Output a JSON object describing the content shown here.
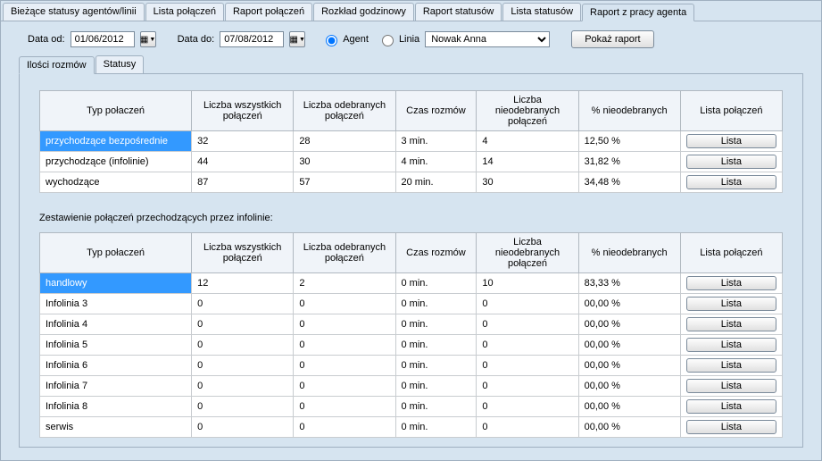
{
  "mainTabs": {
    "t0": "Bieżące statusy agentów/linii",
    "t1": "Lista połączeń",
    "t2": "Raport połączeń",
    "t3": "Rozkład godzinowy",
    "t4": "Raport statusów",
    "t5": "Lista statusów",
    "t6": "Raport z pracy agenta"
  },
  "filters": {
    "dateFromLabel": "Data od:",
    "dateFromValue": "01/06/2012",
    "dateToLabel": "Data do:",
    "dateToValue": "07/08/2012",
    "agentLabel": "Agent",
    "lineLabel": "Linia",
    "agentSelected": "Nowak Anna",
    "showReport": "Pokaż raport"
  },
  "subTabs": {
    "s0": "Ilości rozmów",
    "s1": "Statusy"
  },
  "headers": {
    "type": "Typ połaczeń",
    "all": "Liczba wszystkich połączeń",
    "answered": "Liczba odebranych połączeń",
    "time": "Czas rozmów",
    "missed": "Liczba nieodebranych połączeń",
    "pct": "% nieodebranych",
    "list": "Lista połączeń"
  },
  "listBtn": "Lista",
  "table1": {
    "r0": {
      "c0": "przychodzące bezpośrednie",
      "c1": "32",
      "c2": "28",
      "c3": "3 min.",
      "c4": "4",
      "c5": "12,50 %"
    },
    "r1": {
      "c0": "przychodzące (infolinie)",
      "c1": "44",
      "c2": "30",
      "c3": "4 min.",
      "c4": "14",
      "c5": "31,82 %"
    },
    "r2": {
      "c0": "wychodzące",
      "c1": "87",
      "c2": "57",
      "c3": "20 min.",
      "c4": "30",
      "c5": "34,48 %"
    }
  },
  "sectionLabel": "Zestawienie połączeń przechodzących przez infolinie:",
  "table2": {
    "r0": {
      "c0": "handlowy",
      "c1": "12",
      "c2": "2",
      "c3": "0 min.",
      "c4": "10",
      "c5": "83,33 %"
    },
    "r1": {
      "c0": "Infolinia 3",
      "c1": "0",
      "c2": "0",
      "c3": "0 min.",
      "c4": "0",
      "c5": "00,00 %"
    },
    "r2": {
      "c0": "Infolinia 4",
      "c1": "0",
      "c2": "0",
      "c3": "0 min.",
      "c4": "0",
      "c5": "00,00 %"
    },
    "r3": {
      "c0": "Infolinia 5",
      "c1": "0",
      "c2": "0",
      "c3": "0 min.",
      "c4": "0",
      "c5": "00,00 %"
    },
    "r4": {
      "c0": "Infolinia 6",
      "c1": "0",
      "c2": "0",
      "c3": "0 min.",
      "c4": "0",
      "c5": "00,00 %"
    },
    "r5": {
      "c0": "Infolinia 7",
      "c1": "0",
      "c2": "0",
      "c3": "0 min.",
      "c4": "0",
      "c5": "00,00 %"
    },
    "r6": {
      "c0": "Infolinia 8",
      "c1": "0",
      "c2": "0",
      "c3": "0 min.",
      "c4": "0",
      "c5": "00,00 %"
    },
    "r7": {
      "c0": "serwis",
      "c1": "0",
      "c2": "0",
      "c3": "0 min.",
      "c4": "0",
      "c5": "00,00 %"
    }
  }
}
